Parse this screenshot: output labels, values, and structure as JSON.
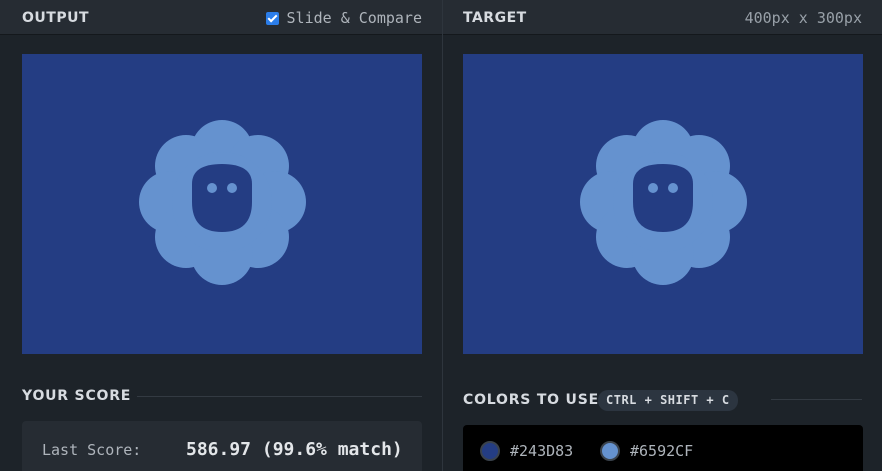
{
  "output": {
    "title": "OUTPUT",
    "compare_label": "Slide & Compare",
    "compare_checked": true
  },
  "target": {
    "title": "TARGET",
    "dimensions": "400px x 300px"
  },
  "score": {
    "title": "YOUR SCORE",
    "last_score_label": "Last Score:",
    "last_score_value": "586.97 (99.6% match)"
  },
  "colors": {
    "title": "COLORS TO USE",
    "shortcut": "CTRL + SHIFT + C",
    "items": [
      {
        "hex": "#243D83"
      },
      {
        "hex": "#6592CF"
      }
    ]
  },
  "palette": {
    "background": "#243d83",
    "foreground": "#6592cf"
  }
}
